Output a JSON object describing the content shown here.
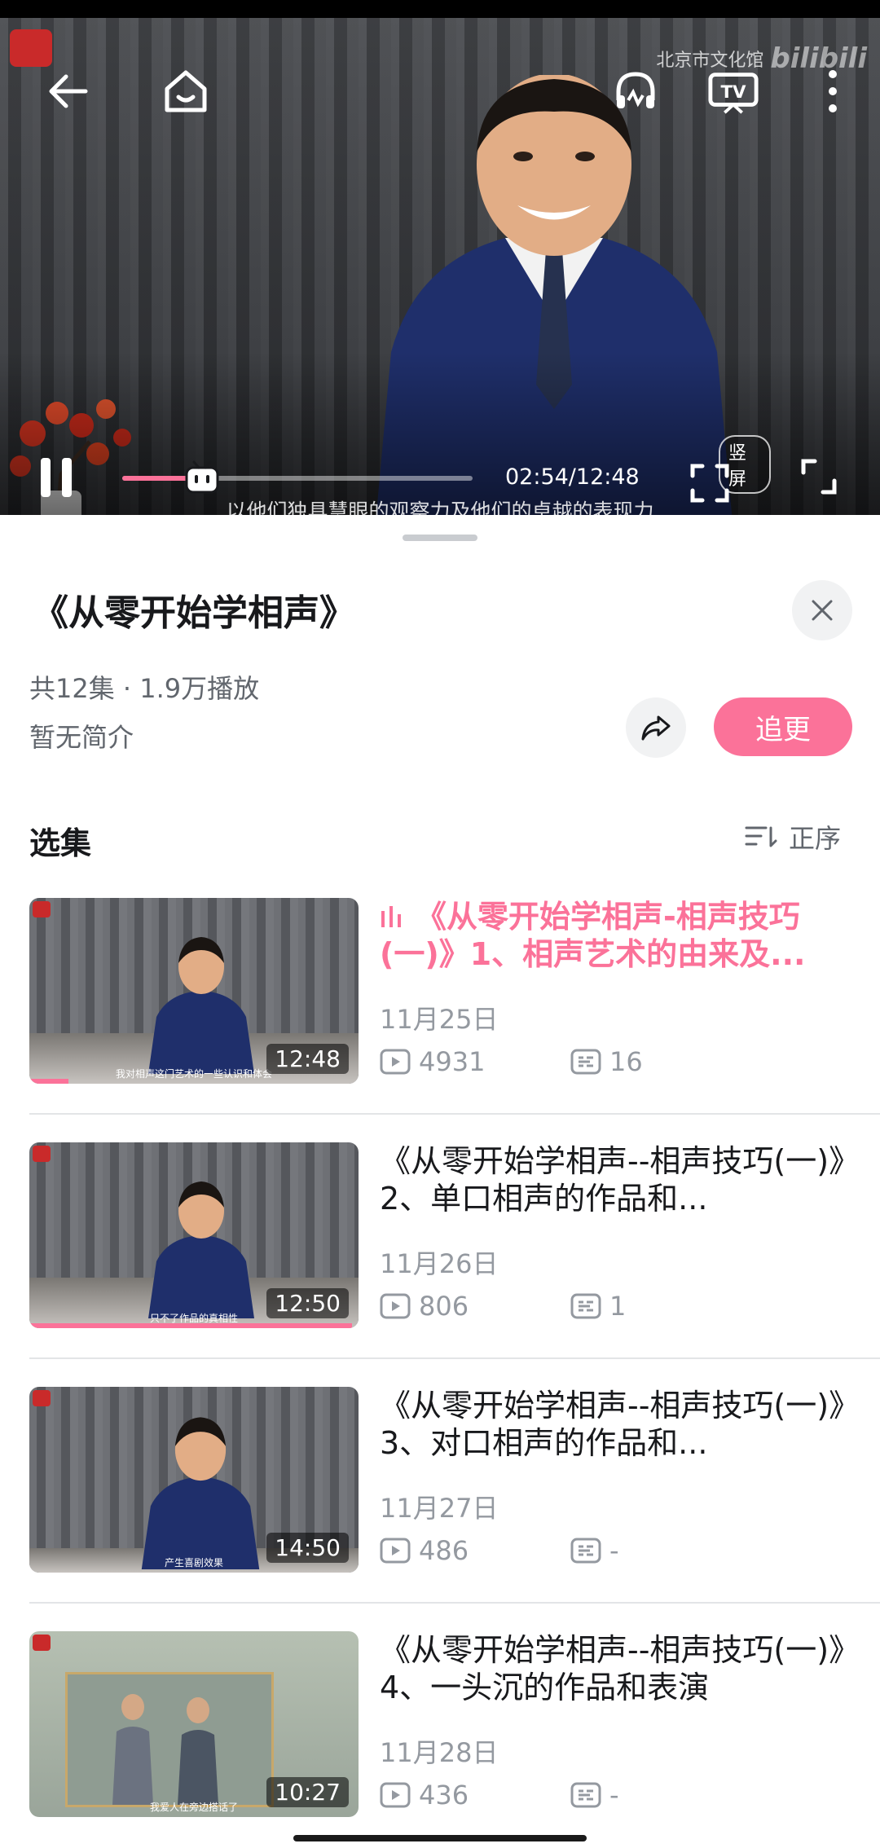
{
  "player": {
    "watermark_text": "北京市文化馆",
    "watermark_brand": "bilibili",
    "time_current": "02:54",
    "time_total": "12:48",
    "time_display": "02:54/12:48",
    "progress_fraction": 0.227,
    "vertical_label": "竖屏",
    "subtitle": "以他们独具慧眼的观察力及他们的卓越的表现力"
  },
  "series": {
    "title": "《从零开始学相声》",
    "meta": "共12集 · 1.9万播放",
    "intro": "暂无简介",
    "follow_label": "追更"
  },
  "section": {
    "title": "选集",
    "sort_label": "正序"
  },
  "episodes": [
    {
      "title": "《从零开始学相声-相声技巧(一)》1、相声艺术的由来及...",
      "date": "11月25日",
      "views": "4931",
      "comments": "16",
      "duration": "12:48",
      "caption": "我对相声这门艺术的一些认识和体会",
      "watched_fraction": 0.12
    },
    {
      "title": "《从零开始学相声--相声技巧(一)》2、单口相声的作品和...",
      "date": "11月26日",
      "views": "806",
      "comments": "1",
      "duration": "12:50",
      "caption": "只不了作品的真相性",
      "watched_fraction": 0.98
    },
    {
      "title": "《从零开始学相声--相声技巧(一)》3、对口相声的作品和...",
      "date": "11月27日",
      "views": "486",
      "comments": "-",
      "duration": "14:50",
      "caption": "产生喜剧效果"
    },
    {
      "title": "《从零开始学相声--相声技巧(一)》4、一头沉的作品和表演",
      "date": "11月28日",
      "views": "436",
      "comments": "-",
      "duration": "10:27",
      "caption": "我爱人在旁边搭话了"
    }
  ],
  "colors": {
    "accent": "#fb7299",
    "text_primary": "#18191c",
    "text_secondary": "#61666d",
    "text_muted": "#9499a0"
  }
}
